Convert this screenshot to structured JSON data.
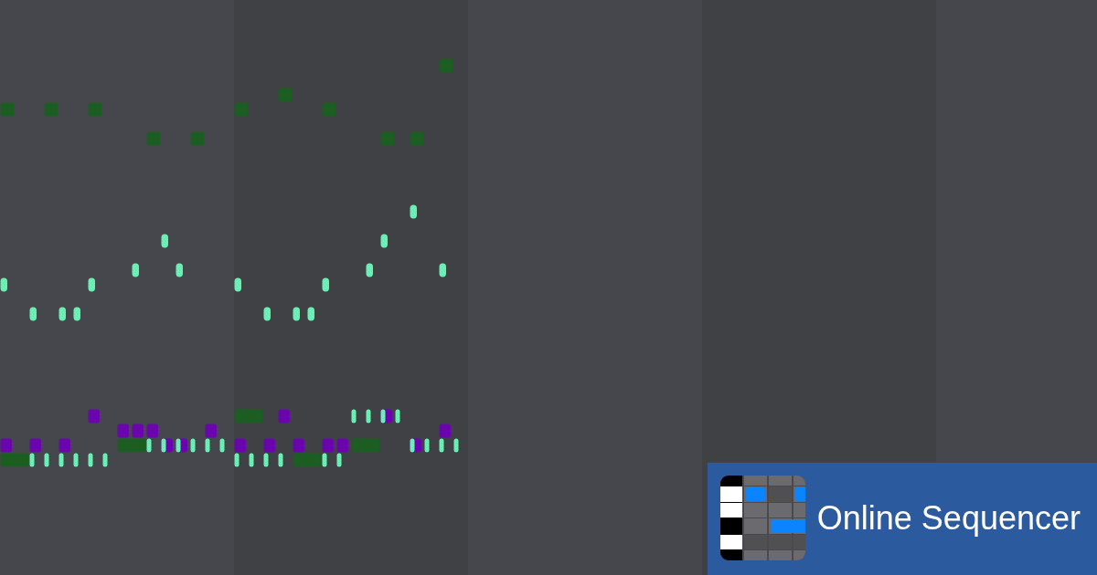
{
  "logo": {
    "text": "Online Sequencer"
  }
}
